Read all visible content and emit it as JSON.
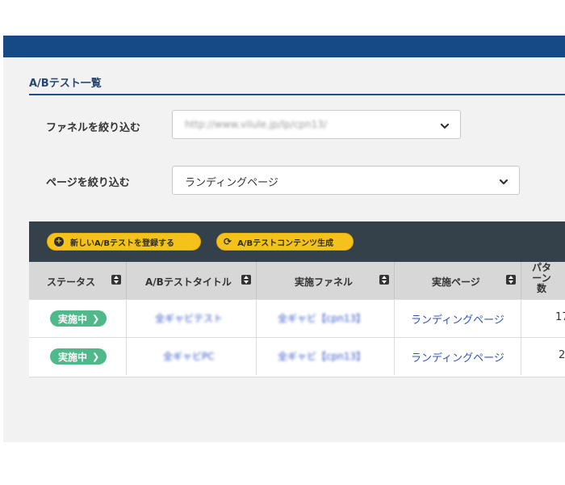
{
  "section_title": "A/Bテスト一覧",
  "filters": {
    "funnel": {
      "label": "ファネルを絞り込む",
      "value": "http://www.vilule.jp/lp/cpn13/"
    },
    "page": {
      "label": "ページを絞り込む",
      "value": "ランディングページ"
    }
  },
  "toolbar": {
    "new_test_label": "新しいA/Bテストを登録する",
    "generate_label": "A/Bテストコンテンツ生成"
  },
  "table": {
    "columns": [
      {
        "key": "status",
        "label": "ステータス"
      },
      {
        "key": "title",
        "label": "A/Bテストタイトル"
      },
      {
        "key": "funnel",
        "label": "実施ファネル"
      },
      {
        "key": "page",
        "label": "実施ページ"
      },
      {
        "key": "patterns",
        "label": "パターン数"
      }
    ],
    "rows": [
      {
        "status": "実施中",
        "title": "全ギャビテスト",
        "funnel": "全ギャビ【cpn13】",
        "page": "ランディングページ",
        "patterns": "17"
      },
      {
        "status": "実施中",
        "title": "全ギャビPC",
        "funnel": "全ギャビ【cpn13】",
        "page": "ランディングページ",
        "patterns": "2"
      }
    ]
  },
  "colors": {
    "topbar": "#164a86",
    "toolbar": "#34404a",
    "button_yellow": "#f5c21b",
    "status_green": "#4fb98c",
    "link_blue": "#2f55b7"
  },
  "icons": {
    "new_test": "plus-circle-icon",
    "generate": "refresh-icon",
    "select_chevron": "chevron-down-icon",
    "sort": "sort-icon",
    "badge_arrow": "chevron-right-icon"
  }
}
